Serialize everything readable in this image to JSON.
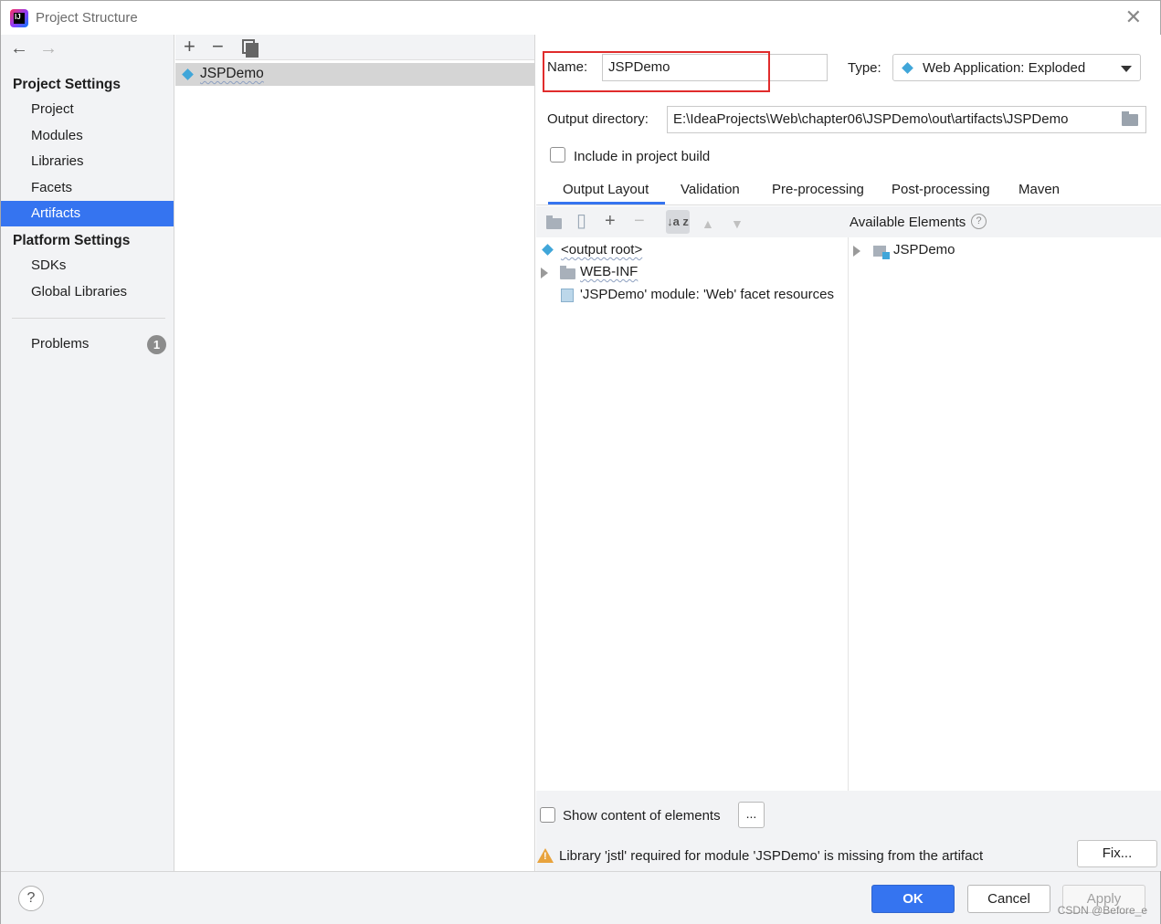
{
  "window": {
    "title": "Project Structure"
  },
  "nav": {
    "project_settings_header": "Project Settings",
    "project_items": [
      "Project",
      "Modules",
      "Libraries",
      "Facets",
      "Artifacts"
    ],
    "selected": "Artifacts",
    "platform_settings_header": "Platform Settings",
    "platform_items": [
      "SDKs",
      "Global Libraries"
    ],
    "problems_label": "Problems",
    "problems_count": "1"
  },
  "artifacts_list": {
    "items": [
      "JSPDemo"
    ]
  },
  "details": {
    "name_label": "Name:",
    "name_value": "JSPDemo",
    "type_label": "Type:",
    "type_value": "Web Application: Exploded",
    "output_dir_label": "Output directory:",
    "output_dir_value": "E:\\IdeaProjects\\Web\\chapter06\\JSPDemo\\out\\artifacts\\JSPDemo",
    "include_in_build_label": "Include in project build",
    "include_in_build_checked": false
  },
  "tabs": [
    "Output Layout",
    "Validation",
    "Pre-processing",
    "Post-processing",
    "Maven"
  ],
  "active_tab": "Output Layout",
  "output_layout": {
    "available_elements_label": "Available Elements",
    "sort_icon_text": "↓a z",
    "left_tree": [
      "<output root>",
      "WEB-INF",
      "'JSPDemo' module: 'Web' facet resources"
    ],
    "right_tree": [
      "JSPDemo"
    ]
  },
  "bottom": {
    "show_content_label": "Show content of elements",
    "show_content_checked": false,
    "ellipsis_label": "...",
    "warning_text": "Library 'jstl' required for module 'JSPDemo' is missing from the artifact",
    "fix_label": "Fix..."
  },
  "footer": {
    "help_label": "?",
    "ok_label": "OK",
    "cancel_label": "Cancel",
    "apply_label": "Apply",
    "watermark": "CSDN @Before_e"
  },
  "colors": {
    "accent": "#3574f0",
    "highlight_box": "#e02c2c",
    "warning": "#e8a33d"
  }
}
